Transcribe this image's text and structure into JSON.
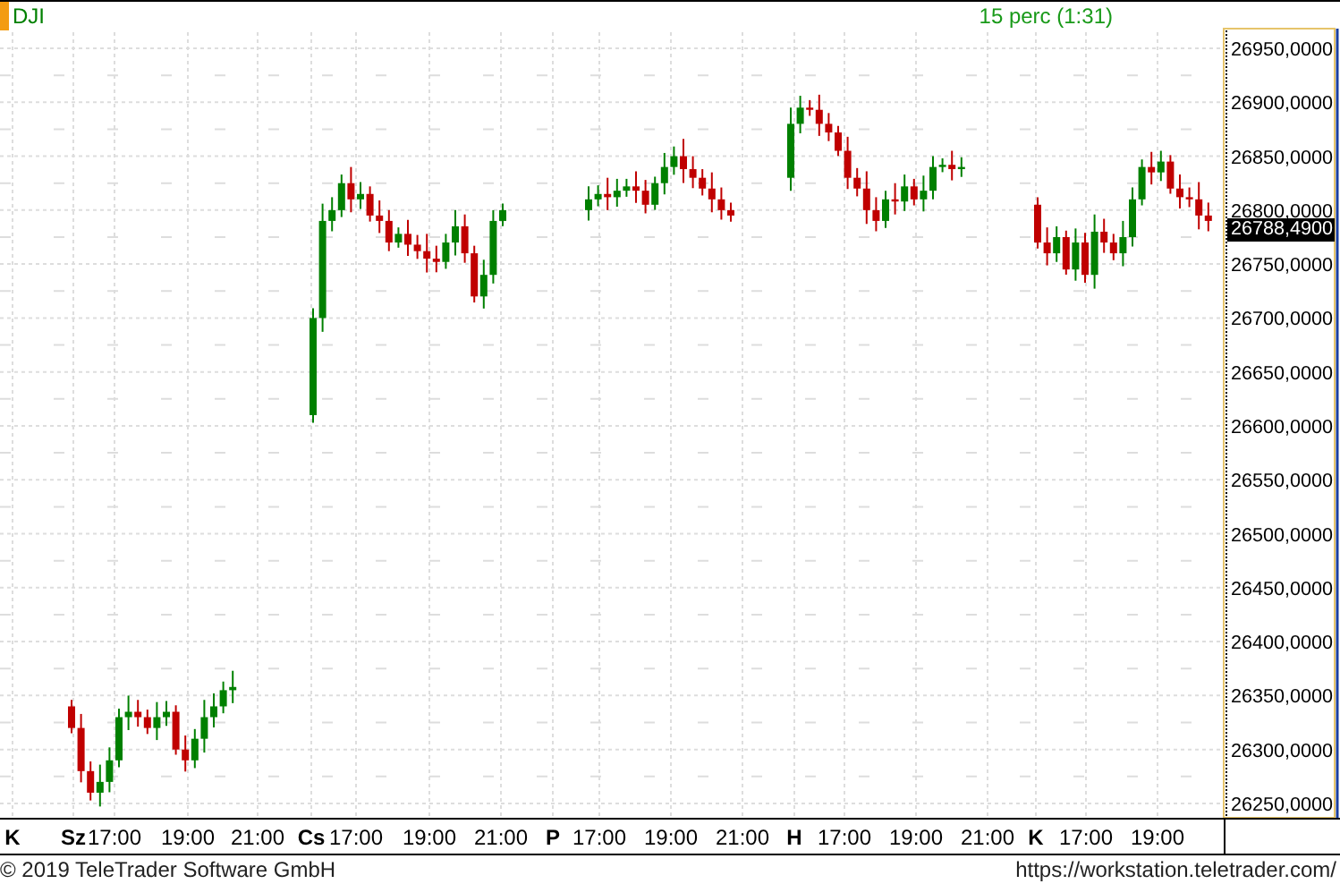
{
  "header": {
    "symbol": "DJI",
    "interval": "15 perc (1:31)"
  },
  "chart": {
    "price_ticks": [
      "26950,0000",
      "26900,0000",
      "26850,0000",
      "26800,0000",
      "26750,0000",
      "26700,0000",
      "26650,0000",
      "26600,0000",
      "26550,0000",
      "26500,0000",
      "26450,0000",
      "26400,0000",
      "26350,0000",
      "26300,0000",
      "26250,0000"
    ],
    "last_price": "26788,4900",
    "time_axis": [
      {
        "label": "K",
        "kind": "day"
      },
      {
        "label": "Sz",
        "kind": "day"
      },
      {
        "label": "17:00",
        "kind": "time"
      },
      {
        "label": "19:00",
        "kind": "time"
      },
      {
        "label": "21:00",
        "kind": "time"
      },
      {
        "label": "Cs",
        "kind": "day"
      },
      {
        "label": "17:00",
        "kind": "time"
      },
      {
        "label": "19:00",
        "kind": "time"
      },
      {
        "label": "21:00",
        "kind": "time"
      },
      {
        "label": "P",
        "kind": "day"
      },
      {
        "label": "17:00",
        "kind": "time"
      },
      {
        "label": "19:00",
        "kind": "time"
      },
      {
        "label": "21:00",
        "kind": "time"
      },
      {
        "label": "H",
        "kind": "day"
      },
      {
        "label": "17:00",
        "kind": "time"
      },
      {
        "label": "19:00",
        "kind": "time"
      },
      {
        "label": "21:00",
        "kind": "time"
      },
      {
        "label": "K",
        "kind": "day"
      },
      {
        "label": "17:00",
        "kind": "time"
      },
      {
        "label": "19:00",
        "kind": "time"
      }
    ]
  },
  "footer": {
    "copyright": "© 2019 TeleTrader Software GmbH",
    "url": "https://workstation.teletrader.com/"
  }
}
